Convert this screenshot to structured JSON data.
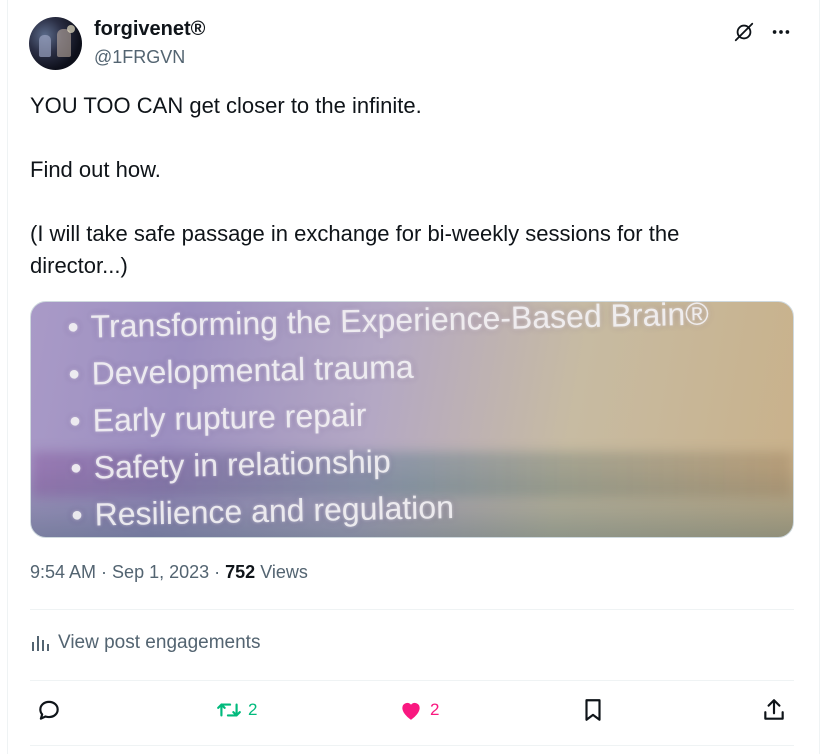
{
  "author": {
    "display_name": "forgivenet®",
    "handle": "@1FRGVN"
  },
  "post": {
    "text": "YOU TOO CAN get closer to the infinite.\n\nFind out how.\n\n(I will take safe passage in exchange for bi-weekly sessions for the director...)",
    "image_bullets": [
      "Transforming the Experience-Based Brain®",
      "Developmental trauma",
      "Early rupture repair",
      "Safety in relationship",
      "Resilience and regulation"
    ]
  },
  "meta": {
    "time": "9:54 AM",
    "date": "Sep 1, 2023",
    "views_count": "752",
    "views_label": "Views"
  },
  "engagements_label": "View post engagements",
  "actions": {
    "reply_icon": "reply-icon",
    "retweet_icon": "retweet-icon",
    "retweet_count": "2",
    "like_icon": "heart-icon",
    "like_count": "2",
    "bookmark_icon": "bookmark-icon",
    "share_icon": "share-icon"
  },
  "colors": {
    "text": "#0f1419",
    "secondary": "#536471",
    "retweet": "#00ba7c",
    "like": "#f91880",
    "border": "#eff3f4"
  }
}
